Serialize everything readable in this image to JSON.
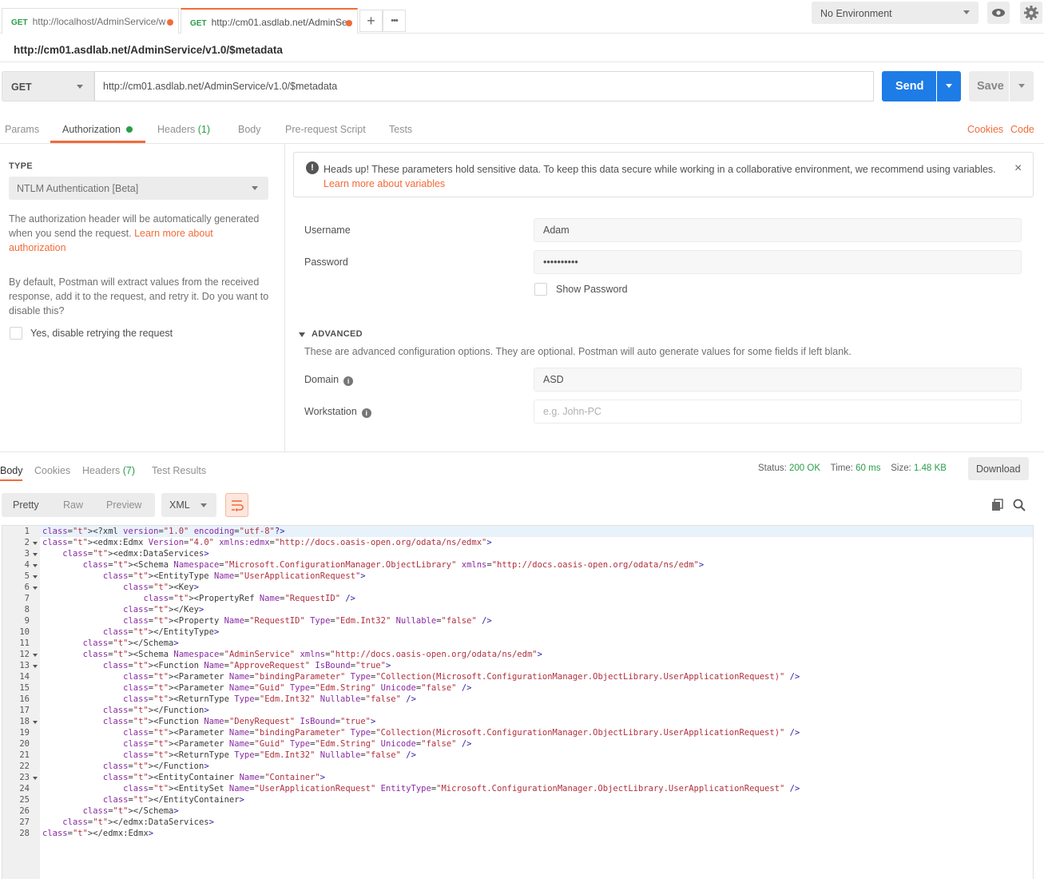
{
  "tabs": [
    {
      "method": "GET",
      "label": "http://localhost/AdminService/w"
    },
    {
      "method": "GET",
      "label": "http://cm01.asdlab.net/AdminSe"
    }
  ],
  "tab_actions": {
    "add": "+",
    "more": "•••"
  },
  "environment": {
    "selected": "No Environment"
  },
  "request": {
    "title": "http://cm01.asdlab.net/AdminService/v1.0/$metadata",
    "method": "GET",
    "url": "http://cm01.asdlab.net/AdminService/v1.0/$metadata",
    "send_label": "Send",
    "save_label": "Save"
  },
  "request_tabs": {
    "params": "Params",
    "authorization": "Authorization",
    "headers": "Headers",
    "headers_count": "(1)",
    "body": "Body",
    "prerequest": "Pre-request Script",
    "tests": "Tests",
    "cookies": "Cookies",
    "code": "Code"
  },
  "auth": {
    "type_label": "TYPE",
    "type_value": "NTLM Authentication [Beta]",
    "desc": "The authorization header will be automatically generated when you send the request.",
    "desc_link": "Learn more about authorization",
    "retry_desc": "By default, Postman will extract values from the received response, add it to the request, and retry it. Do you want to disable this?",
    "retry_checkbox": "Yes, disable retrying the request"
  },
  "alert": {
    "icon": "!",
    "text": "Heads up! These parameters hold sensitive data. To keep this data secure while working in a collaborative environment, we recommend using variables.",
    "link": "Learn more about variables",
    "close": "×"
  },
  "fields": {
    "username_label": "Username",
    "username_value": "Adam",
    "password_label": "Password",
    "password_value": "••••••••••",
    "show_password": "Show Password",
    "advanced_label": "ADVANCED",
    "advanced_desc": "These are advanced configuration options. They are optional. Postman will auto generate values for some fields if left blank.",
    "domain_label": "Domain",
    "domain_value": "ASD",
    "workstation_label": "Workstation",
    "workstation_placeholder": "e.g. John-PC",
    "info_icon": "i"
  },
  "response": {
    "tabs": {
      "body": "Body",
      "cookies": "Cookies",
      "headers": "Headers",
      "headers_count": "(7)",
      "tests": "Test Results"
    },
    "status_label": "Status:",
    "status_value": "200 OK",
    "time_label": "Time:",
    "time_value": "60 ms",
    "size_label": "Size:",
    "size_value": "1.48 KB",
    "download": "Download",
    "views": {
      "pretty": "Pretty",
      "raw": "Raw",
      "preview": "Preview"
    },
    "format": "XML"
  },
  "code_lines": [
    "<?xml version=\"1.0\" encoding=\"utf-8\"?>",
    "<edmx:Edmx Version=\"4.0\" xmlns:edmx=\"http://docs.oasis-open.org/odata/ns/edmx\">",
    "    <edmx:DataServices>",
    "        <Schema Namespace=\"Microsoft.ConfigurationManager.ObjectLibrary\" xmlns=\"http://docs.oasis-open.org/odata/ns/edm\">",
    "            <EntityType Name=\"UserApplicationRequest\">",
    "                <Key>",
    "                    <PropertyRef Name=\"RequestID\" />",
    "                </Key>",
    "                <Property Name=\"RequestID\" Type=\"Edm.Int32\" Nullable=\"false\" />",
    "            </EntityType>",
    "        </Schema>",
    "        <Schema Namespace=\"AdminService\" xmlns=\"http://docs.oasis-open.org/odata/ns/edm\">",
    "            <Function Name=\"ApproveRequest\" IsBound=\"true\">",
    "                <Parameter Name=\"bindingParameter\" Type=\"Collection(Microsoft.ConfigurationManager.ObjectLibrary.UserApplicationRequest)\" />",
    "                <Parameter Name=\"Guid\" Type=\"Edm.String\" Unicode=\"false\" />",
    "                <ReturnType Type=\"Edm.Int32\" Nullable=\"false\" />",
    "            </Function>",
    "            <Function Name=\"DenyRequest\" IsBound=\"true\">",
    "                <Parameter Name=\"bindingParameter\" Type=\"Collection(Microsoft.ConfigurationManager.ObjectLibrary.UserApplicationRequest)\" />",
    "                <Parameter Name=\"Guid\" Type=\"Edm.String\" Unicode=\"false\" />",
    "                <ReturnType Type=\"Edm.Int32\" Nullable=\"false\" />",
    "            </Function>",
    "            <EntityContainer Name=\"Container\">",
    "                <EntitySet Name=\"UserApplicationRequest\" EntityType=\"Microsoft.ConfigurationManager.ObjectLibrary.UserApplicationRequest\" />",
    "            </EntityContainer>",
    "        </Schema>",
    "    </edmx:DataServices>",
    "</edmx:Edmx>"
  ],
  "foldable_lines": [
    2,
    3,
    4,
    5,
    6,
    12,
    13,
    18,
    23
  ]
}
